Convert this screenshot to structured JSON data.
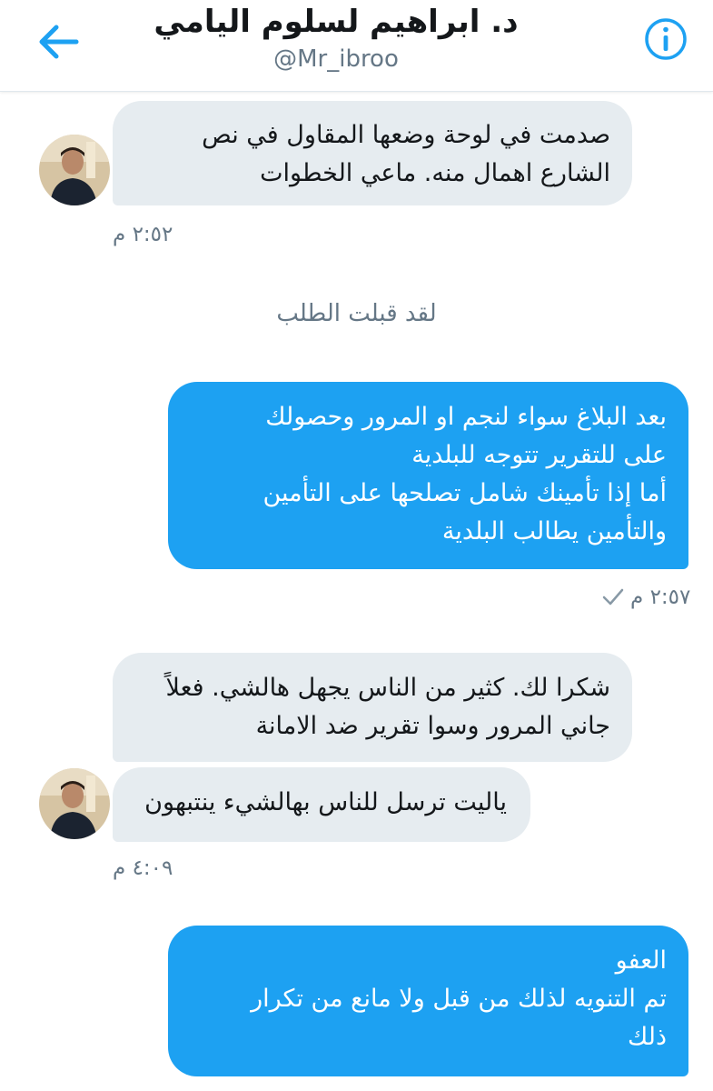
{
  "header": {
    "title": "د. ابراهيم لسلوم اليامي",
    "handle": "@Mr_ibroo",
    "back_icon": "arrow-left-icon",
    "info_icon": "info-icon"
  },
  "colors": {
    "accent": "#1da1f2",
    "incoming_bubble": "#e6ecf0",
    "meta_text": "#657786"
  },
  "messages": [
    {
      "direction": "incoming",
      "lines": [
        "صدمت في لوحة وضعها المقاول في نص",
        "الشارع اهمال منه. ماعي الخطوات"
      ],
      "time": "٢:٥٢ م"
    },
    {
      "direction": "system",
      "text": "لقد قبلت الطلب"
    },
    {
      "direction": "outgoing",
      "lines": [
        "بعد البلاغ سواء لنجم او المرور وحصولك",
        "على للتقرير تتوجه للبلدية",
        "أما إذا تأمينك شامل تصلحها على التأمين",
        "والتأمين يطالب البلدية"
      ],
      "time": "٢:٥٧ م"
    },
    {
      "direction": "incoming",
      "lines": [
        "شكرا لك. كثير من الناس يجهل هالشي. فعلاً",
        "جاني المرور وسوا تقرير ضد الامانة"
      ]
    },
    {
      "direction": "incoming",
      "lines": [
        "ياليت ترسل للناس بهالشيء ينتبهون"
      ],
      "time": "٤:٠٩ م"
    },
    {
      "direction": "outgoing",
      "lines": [
        "العفو",
        "تم التنويه لذلك من قبل ولا مانع من تكرار",
        "ذلك"
      ]
    }
  ]
}
